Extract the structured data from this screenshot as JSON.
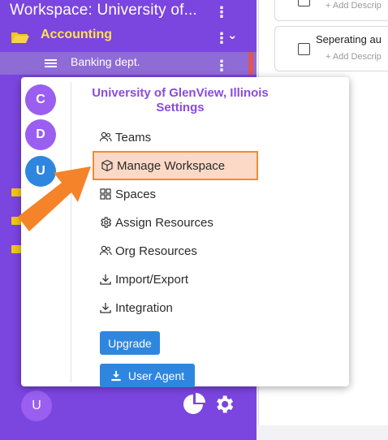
{
  "sidebar": {
    "workspace_title": "Workspace: University of...",
    "folder_label": "Accounting",
    "subitem_label": "Banking dept.",
    "user_initial": "U"
  },
  "tasks": [
    {
      "title": "",
      "desc": "+ Add Descrip"
    },
    {
      "title": "Seperating au",
      "desc": "+ Add Descrip"
    }
  ],
  "popup": {
    "workspace_initials": [
      "C",
      "D",
      "U"
    ],
    "title": "University of GlenView, Illinois Settings",
    "menu": {
      "teams": "Teams",
      "manage_workspace": "Manage Workspace",
      "spaces": "Spaces",
      "assign_resources": "Assign Resources",
      "org_resources": "Org Resources",
      "import_export": "Import/Export",
      "integration": "Integration"
    },
    "upgrade_label": "Upgrade",
    "user_agent_label": "User Agent"
  },
  "colors": {
    "sidebar_bg": "#7b45df",
    "folder_label": "#ffe14d",
    "popup_title": "#8a4be0",
    "avatar_c": "#9a5ff0",
    "avatar_d": "#9a5ff0",
    "avatar_u": "#2f86de",
    "button_blue": "#2f86de",
    "highlight_border": "#f08c34",
    "highlight_fill": "#fbd9c6",
    "arrow": "#f5832a"
  }
}
